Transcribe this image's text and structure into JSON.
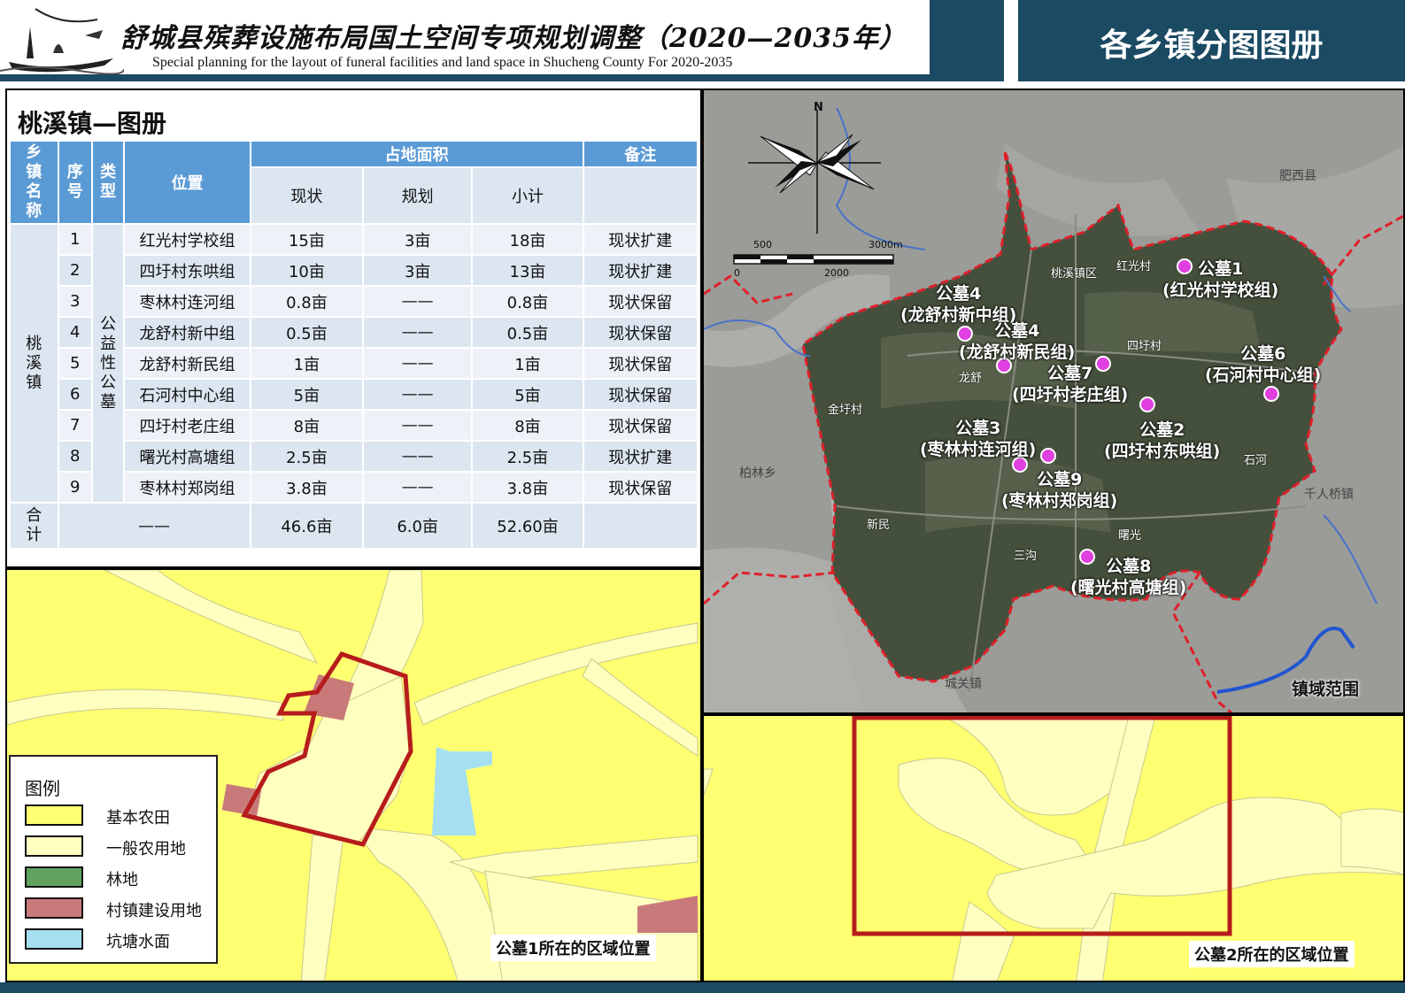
{
  "header": {
    "title_zh": "舒城县殡葬设施布局国土空间专项规划调整（2020—2035年）",
    "title_en": "Special planning for the layout of funeral facilities and land space in Shucheng County For 2020-2035",
    "right_title": "各乡镇分图图册"
  },
  "panel_title": "桃溪镇—图册",
  "table": {
    "headers": {
      "town": "乡镇名称",
      "index": "序号",
      "type": "类型",
      "location": "位置",
      "area": "占地面积",
      "note": "备注",
      "current": "现状",
      "planned": "规划",
      "subtotal": "小计"
    },
    "town_name": "桃溪镇",
    "type_name": "公益性公墓",
    "rows": [
      {
        "no": "1",
        "loc": "红光村学校组",
        "cur": "15亩",
        "plan": "3亩",
        "sub": "18亩",
        "note": "现状扩建"
      },
      {
        "no": "2",
        "loc": "四圩村东哄组",
        "cur": "10亩",
        "plan": "3亩",
        "sub": "13亩",
        "note": "现状扩建"
      },
      {
        "no": "3",
        "loc": "枣林村连河组",
        "cur": "0.8亩",
        "plan": "——",
        "sub": "0.8亩",
        "note": "现状保留"
      },
      {
        "no": "4",
        "loc": "龙舒村新中组",
        "cur": "0.5亩",
        "plan": "——",
        "sub": "0.5亩",
        "note": "现状保留"
      },
      {
        "no": "5",
        "loc": "龙舒村新民组",
        "cur": "1亩",
        "plan": "——",
        "sub": "1亩",
        "note": "现状保留"
      },
      {
        "no": "6",
        "loc": "石河村中心组",
        "cur": "5亩",
        "plan": "——",
        "sub": "5亩",
        "note": "现状保留"
      },
      {
        "no": "7",
        "loc": "四圩村老庄组",
        "cur": "8亩",
        "plan": "——",
        "sub": "8亩",
        "note": "现状保留"
      },
      {
        "no": "8",
        "loc": "曙光村高塘组",
        "cur": "2.5亩",
        "plan": "——",
        "sub": "2.5亩",
        "note": "现状扩建"
      },
      {
        "no": "9",
        "loc": "枣林村郑岗组",
        "cur": "3.8亩",
        "plan": "——",
        "sub": "3.8亩",
        "note": "现状保留"
      }
    ],
    "total": {
      "label": "合计",
      "dash": "——",
      "cur": "46.6亩",
      "plan": "6.0亩",
      "sub": "52.60亩"
    }
  },
  "legend": {
    "title": "图例",
    "items": [
      {
        "label": "基本农田",
        "color": "#ffff72"
      },
      {
        "label": "一般农用地",
        "color": "#ffffc0"
      },
      {
        "label": "林地",
        "color": "#5fa35f"
      },
      {
        "label": "村镇建设用地",
        "color": "#c87a7a"
      },
      {
        "label": "坑塘水面",
        "color": "#a6e0f0"
      }
    ]
  },
  "map1_caption": "公墓1所在的区域位置",
  "map2_caption": "公墓2所在的区域位置",
  "sat_map": {
    "north": "N",
    "scale": {
      "top_left": "500",
      "top_right": "3000m",
      "bottom_left": "0",
      "bottom_mid": "2000"
    },
    "caption": "镇域范围",
    "cemeteries": [
      {
        "name": "公墓1",
        "sub": "(红光村学校组)"
      },
      {
        "name": "公墓4",
        "sub": "(龙舒村新中组)"
      },
      {
        "name": "公墓4",
        "sub": "(龙舒村新民组)"
      },
      {
        "name": "公墓7",
        "sub": "(四圩村老庄组)"
      },
      {
        "name": "公墓6",
        "sub": "(石河村中心组)"
      },
      {
        "name": "公墓2",
        "sub": "(四圩村东哄组)"
      },
      {
        "name": "公墓3",
        "sub": "(枣林村连河组)"
      },
      {
        "name": "公墓9",
        "sub": "(枣林村郑岗组)"
      },
      {
        "name": "公墓8",
        "sub": "(曙光村高塘组)"
      }
    ],
    "places": {
      "taoxi": "桃溪镇区",
      "hongguang": "红光村",
      "sixu": "四圩村",
      "longshu": "龙舒",
      "jinxu": "金圩村",
      "shihe": "石河",
      "xinmin": "新民",
      "sangou": "三沟",
      "shuguang": "曙光"
    },
    "neighbors": {
      "feixi": "肥西县",
      "bailin": "柏林乡",
      "qianren": "千人桥镇",
      "chengguan": "城关镇"
    }
  },
  "colors": {
    "header": "#1b4a63",
    "table_head": "#5b9bd5",
    "boundary": "#e0202a",
    "plot": "#b71c1c"
  }
}
